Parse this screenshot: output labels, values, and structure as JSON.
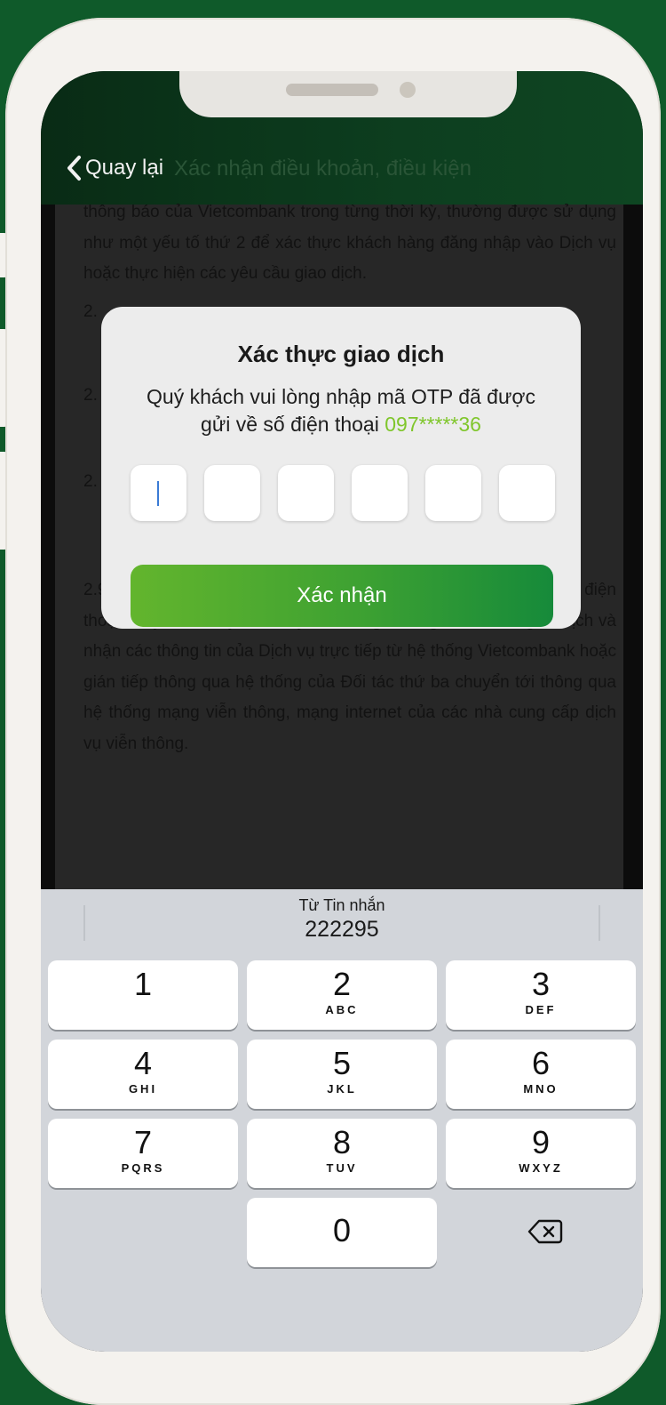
{
  "nav": {
    "back_label": "Quay lại",
    "title": "Xác nhận điều khoản, điều kiện"
  },
  "document": {
    "paragraphs": [
      "thông báo của Vietcombank trong từng thời kỳ, thường được sử dụng như một yếu tố thứ 2 để xác thực khách hàng đăng nhập vào Dịch vụ hoặc thực hiện các yêu cầu giao dịch.",
      "2.",
      "2.",
      "2.",
      "2.9. ... hàng sử dụng bao gồm nhưng không giới hạn như máy điện thoại, máy tính, máy fax, máy tính bảng,... để gửi Yêu cầu giao dịch và nhận các thông tin của Dịch vụ trực tiếp từ hệ thống Vietcombank hoặc gián tiếp thông qua hệ thống của Đối tác thứ ba chuyển tới thông qua hệ thống mạng viễn thông, mạng internet của các nhà cung cấp dịch vụ viễn thông."
    ]
  },
  "modal": {
    "title": "Xác thực giao dịch",
    "message": "Quý khách vui lòng nhập mã OTP đã được gửi về số điện thoại",
    "phone": "097*****36",
    "confirm_label": "Xác nhận",
    "otp_values": [
      "",
      "",
      "",
      "",
      "",
      ""
    ]
  },
  "keyboard": {
    "suggestion_source": "Từ Tin nhắn",
    "suggestion_code": "222295",
    "keys": [
      {
        "num": "1",
        "letters": ""
      },
      {
        "num": "2",
        "letters": "ABC"
      },
      {
        "num": "3",
        "letters": "DEF"
      },
      {
        "num": "4",
        "letters": "GHI"
      },
      {
        "num": "5",
        "letters": "JKL"
      },
      {
        "num": "6",
        "letters": "MNO"
      },
      {
        "num": "7",
        "letters": "PQRS"
      },
      {
        "num": "8",
        "letters": "TUV"
      },
      {
        "num": "9",
        "letters": "WXYZ"
      },
      {
        "num": "0",
        "letters": ""
      }
    ],
    "delete_icon": "delete-backspace-icon"
  },
  "colors": {
    "accent_green": "#3da132",
    "phone_highlight": "#7fc62b",
    "background": "#0f5a2a"
  }
}
